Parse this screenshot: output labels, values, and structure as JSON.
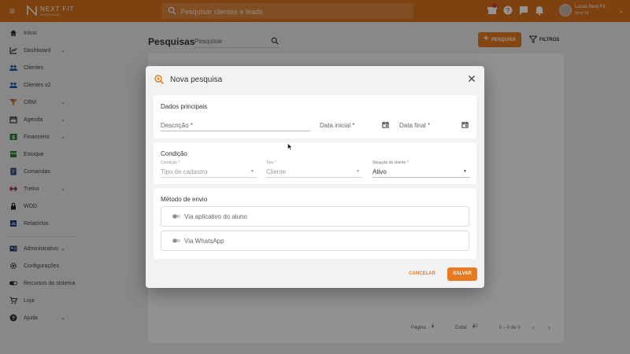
{
  "topbar": {
    "logo_name": "NEXT FIT",
    "logo_sub": "NOROWAM",
    "search_placeholder": "Pesquisar clientes e leads",
    "user_name": "Lucas Next Fit",
    "user_sub": "Next Fit",
    "color": "#d9711c"
  },
  "sidebar": {
    "items": [
      {
        "label": "Início",
        "icon": "home-icon"
      },
      {
        "label": "Dashboard",
        "icon": "chart-icon"
      },
      {
        "label": "Clientes",
        "icon": "people-icon"
      },
      {
        "label": "Clientes v2",
        "icon": "people-icon"
      },
      {
        "label": "CRM",
        "icon": "funnel-icon"
      },
      {
        "label": "Agenda",
        "icon": "calendar-icon"
      },
      {
        "label": "Financeiro",
        "icon": "money-icon"
      },
      {
        "label": "Estoque",
        "icon": "box-icon"
      },
      {
        "label": "Comandas",
        "icon": "receipt-icon"
      },
      {
        "label": "Treino",
        "icon": "dumbbell-icon"
      },
      {
        "label": "WOD",
        "icon": "lock-icon"
      },
      {
        "label": "Relatórios",
        "icon": "report-icon"
      },
      {
        "label": "Administrativo",
        "icon": "admin-icon"
      },
      {
        "label": "Configurações",
        "icon": "gear-icon"
      },
      {
        "label": "Recursos do sistema",
        "icon": "toggle-icon"
      },
      {
        "label": "Loja",
        "icon": "cart-icon"
      },
      {
        "label": "Ajuda",
        "icon": "help-icon"
      }
    ]
  },
  "main": {
    "title": "Pesquisas",
    "search_placeholder": "Pesquisar",
    "new_button": "PESQUISA",
    "filters_button": "FILTROS",
    "pager": {
      "page_label": "Página",
      "page": "1",
      "show_label": "Exibir",
      "show": "20",
      "range": "0 – 0 de 0"
    }
  },
  "dialog": {
    "title": "Nova pesquisa",
    "section1": {
      "title": "Dados principais",
      "description_label": "Descrição *",
      "start_label": "Data inicial *",
      "end_label": "Data final *"
    },
    "section2": {
      "title": "Condição",
      "condition_label": "Condição *",
      "condition_value": "Tipo de cadastro",
      "type_label": "Tipo *",
      "type_value": "Cliente",
      "status_label": "Situação do cliente *",
      "status_value": "Ativo"
    },
    "section3": {
      "title": "Método de envio",
      "option1": "Via aplicativo do aluno",
      "option2": "Via WhatsApp"
    },
    "cancel_label": "CANCELAR",
    "save_label": "SALVAR",
    "accent": "#e67a20"
  }
}
